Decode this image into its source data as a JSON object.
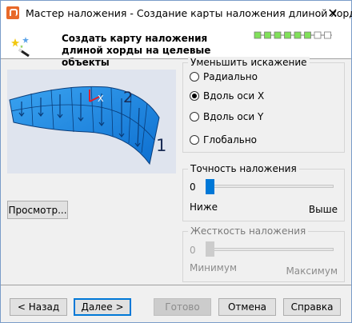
{
  "window": {
    "title": "Мастер наложения - Создание карты наложения длиной хорды",
    "close_glyph": "✕",
    "app_icon": "app-logo-icon"
  },
  "header": {
    "title": "Создать карту наложения длиной хорды на целевые объекты",
    "icon": "wizard-wand-icon",
    "progress": {
      "steps_total": 8,
      "steps_completed": 6,
      "active_color": "#80e05a"
    }
  },
  "preview": {
    "axis_labels": [
      "X",
      "2",
      "1"
    ],
    "button_label": "Просмотр..."
  },
  "distortion": {
    "legend": "Уменьшить искажение",
    "options": [
      {
        "label": "Радиально",
        "checked": false
      },
      {
        "label": "Вдоль оси X",
        "checked": true
      },
      {
        "label": "Вдоль оси Y",
        "checked": false
      },
      {
        "label": "Глобально",
        "checked": false
      }
    ]
  },
  "accuracy": {
    "legend": "Точность наложения",
    "value": "0",
    "level": 0,
    "min_label": "Ниже",
    "max_label": "Выше"
  },
  "stiffness": {
    "legend": "Жесткость наложения",
    "value": "0",
    "level": 0,
    "min_label": "Минимум",
    "max_label": "Максимум"
  },
  "footer": {
    "back": "< Назад",
    "next": "Далее >",
    "finish": "Готово",
    "cancel": "Отмена",
    "help": "Справка"
  },
  "colors": {
    "accent": "#0078d7",
    "surface": "#1e8fe8",
    "axis_red": "#e0202a"
  }
}
